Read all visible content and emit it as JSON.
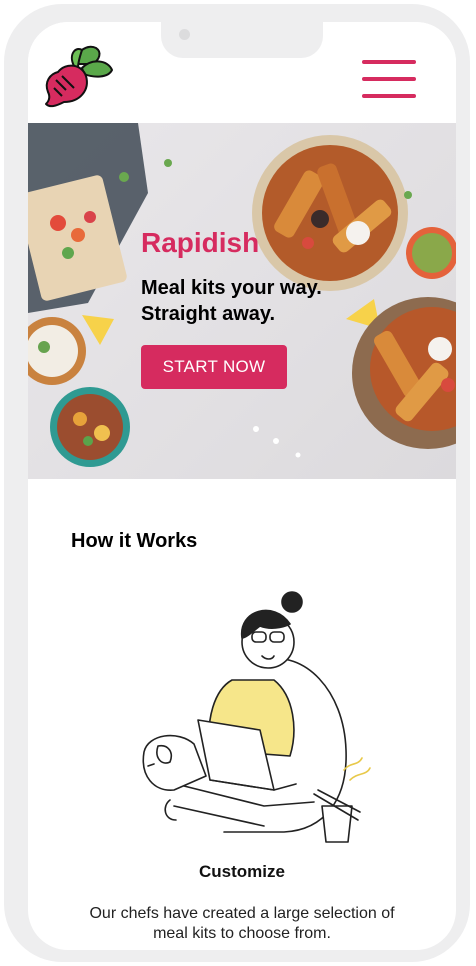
{
  "header": {
    "logo_icon": "beet-icon",
    "menu_icon": "hamburger-menu-icon"
  },
  "hero": {
    "brand": "Rapidish",
    "tagline_line1": "Meal kits your way.",
    "tagline_line2": "Straight away.",
    "cta_label": "START NOW"
  },
  "how_it_works": {
    "title": "How it Works",
    "step_title": "Customize",
    "step_description": "Our chefs have created a large selection of meal kits to choose from.",
    "illustration": "woman-with-laptop-and-dog-illustration"
  },
  "colors": {
    "accent": "#d62b5f",
    "frame": "#eeeeef",
    "illustration_highlight": "#f6e68a"
  }
}
